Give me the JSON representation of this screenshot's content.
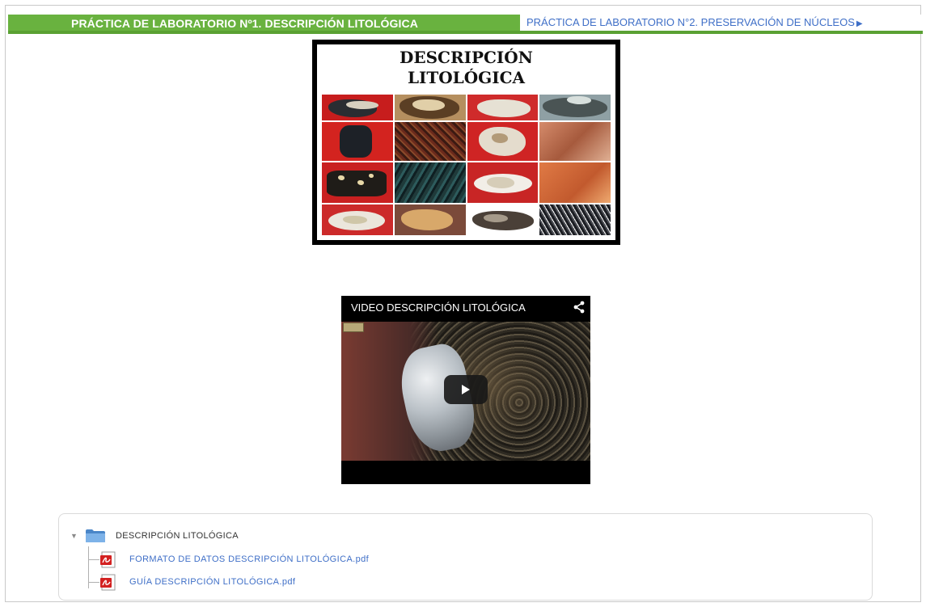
{
  "nav": {
    "current_section": "PRÁCTICA DE LABORATORIO Nº1. DESCRIPCIÓN LITOLÓGICA",
    "next_section": "PRÁCTICA DE LABORATORIO N°2. PRESERVACIÓN DE NÚCLEOS",
    "next_arrow": "▶",
    "bar_color": "#69b23f",
    "link_color": "#3f6fc7"
  },
  "banner": {
    "title_line1": "DESCRIPCIÓN",
    "title_line2": "LITOLÓGICA"
  },
  "video": {
    "title": "VIDEO DESCRIPCIÓN LITOLÓGICA",
    "share_icon": "share-icon",
    "play_icon": "play-icon"
  },
  "folder": {
    "name": "DESCRIPCIÓN LITOLÓGICA",
    "toggle_icon": "▼",
    "files": [
      {
        "name": "FORMATO DE DATOS DESCRIPCIÓN LITOLÓGICA.pdf",
        "icon": "pdf-icon"
      },
      {
        "name": "GUÍA DESCRIPCIÓN LITOLÓGICA.pdf",
        "icon": "pdf-icon"
      }
    ]
  }
}
